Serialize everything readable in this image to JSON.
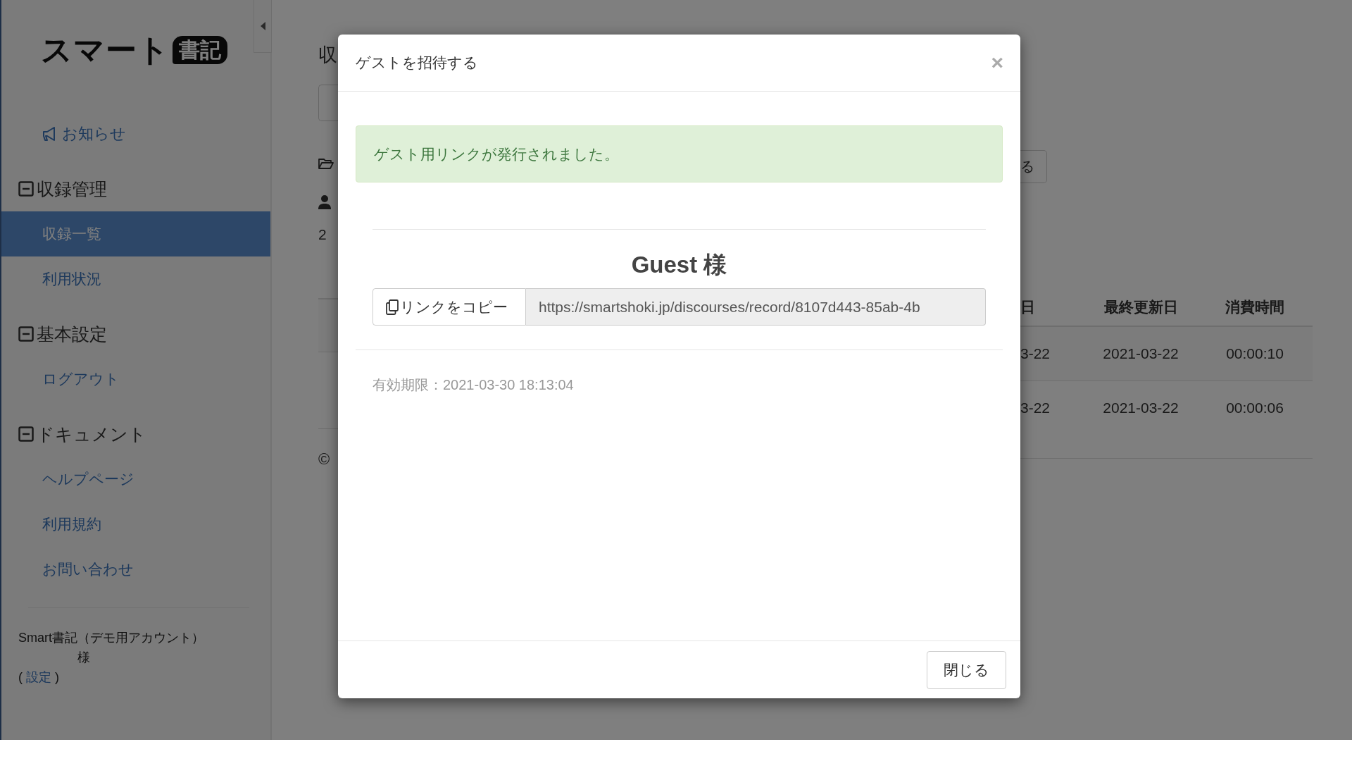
{
  "sidebar": {
    "logo": {
      "text": "スマート",
      "badge": "書記"
    },
    "notice": "お知らせ",
    "sections": [
      {
        "title": "収録管理",
        "expanded": true,
        "items": [
          {
            "label": "収録一覧",
            "selected": true
          },
          {
            "label": "利用状況",
            "selected": false
          }
        ]
      },
      {
        "title": "基本設定",
        "expanded": true,
        "items": [
          {
            "label": "ログアウト",
            "selected": false
          }
        ]
      },
      {
        "title": "ドキュメント",
        "expanded": true,
        "items": [
          {
            "label": "ヘルプページ",
            "selected": false
          },
          {
            "label": "利用規約",
            "selected": false
          },
          {
            "label": "お問い合わせ",
            "selected": false
          }
        ]
      }
    ],
    "account": {
      "name": "Smart書記（デモ用アカウント）",
      "suffix": "様",
      "paren_open": "(",
      "settings_link": "設定",
      "paren_close": ")"
    }
  },
  "background": {
    "title": "収",
    "count": "2",
    "copyright": "©",
    "button": "る",
    "table": {
      "columns": [
        "日",
        "最終更新日",
        "消費時間"
      ],
      "rows": [
        [
          "3-22",
          "2021-03-22",
          "00:00:10"
        ],
        [
          "3-22",
          "2021-03-22",
          "00:00:06"
        ]
      ]
    }
  },
  "modal": {
    "title": "ゲストを招待する",
    "close": "×",
    "alert": "ゲスト用リンクが発行されました。",
    "guest_name": "Guest 様",
    "copy_button": "リンクをコピー",
    "link": "https://smartshoki.jp/discourses/record/8107d443-85ab-4b",
    "expiry": "有効期限：2021-03-30 18:13:04",
    "close_button": "閉じる"
  }
}
